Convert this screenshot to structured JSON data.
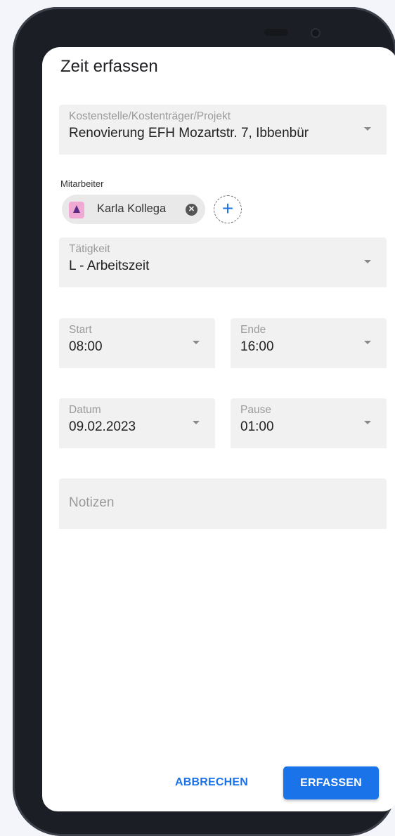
{
  "dialog": {
    "title": "Zeit erfassen"
  },
  "kostenstelle": {
    "label": "Kostenstelle/Kostenträger/Projekt",
    "value": "Renovierung EFH Mozartstr. 7, Ibbenbür"
  },
  "mitarbeiter": {
    "label": "Mitarbeiter",
    "chips": [
      {
        "name": "Karla Kollega"
      }
    ],
    "add_glyph": "+"
  },
  "taetigkeit": {
    "label": "Tätigkeit",
    "value": "L - Arbeitszeit"
  },
  "start": {
    "label": "Start",
    "value": "08:00"
  },
  "ende": {
    "label": "Ende",
    "value": "16:00"
  },
  "datum": {
    "label": "Datum",
    "value": "09.02.2023"
  },
  "pause": {
    "label": "Pause",
    "value": "01:00"
  },
  "notizen": {
    "placeholder": "Notizen"
  },
  "actions": {
    "cancel": "ABBRECHEN",
    "submit": "ERFASSEN"
  },
  "colors": {
    "accent": "#1a73e8",
    "field_bg": "#f1f1f1"
  }
}
